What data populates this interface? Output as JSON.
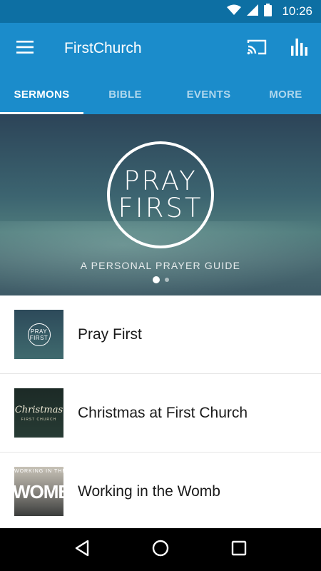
{
  "status_bar": {
    "time": "10:26"
  },
  "app_bar": {
    "title": "FirstChurch",
    "menu_icon": "menu-icon",
    "cast_icon": "cast-icon",
    "stats_icon": "bar-chart-icon"
  },
  "tabs": [
    {
      "label": "SERMONS",
      "active": true
    },
    {
      "label": "BIBLE",
      "active": false
    },
    {
      "label": "EVENTS",
      "active": false
    },
    {
      "label": "MORE",
      "active": false
    }
  ],
  "hero": {
    "line1": "PRAY",
    "line2": "FIRST",
    "subtitle": "A PERSONAL PRAYER GUIDE",
    "slide_count": 2,
    "active_slide": 1
  },
  "sermons": [
    {
      "title": "Pray First",
      "thumb_line1": "PRAY",
      "thumb_line2": "FIRST"
    },
    {
      "title": "Christmas at First Church",
      "thumb_big": "Christmas",
      "thumb_small": "FIRST CHURCH"
    },
    {
      "title": "Working in the Womb",
      "thumb_top": "WORKING IN THE",
      "thumb_big": "WOMB"
    }
  ],
  "colors": {
    "primary": "#1b8ccb",
    "status": "#0d6fa3"
  }
}
